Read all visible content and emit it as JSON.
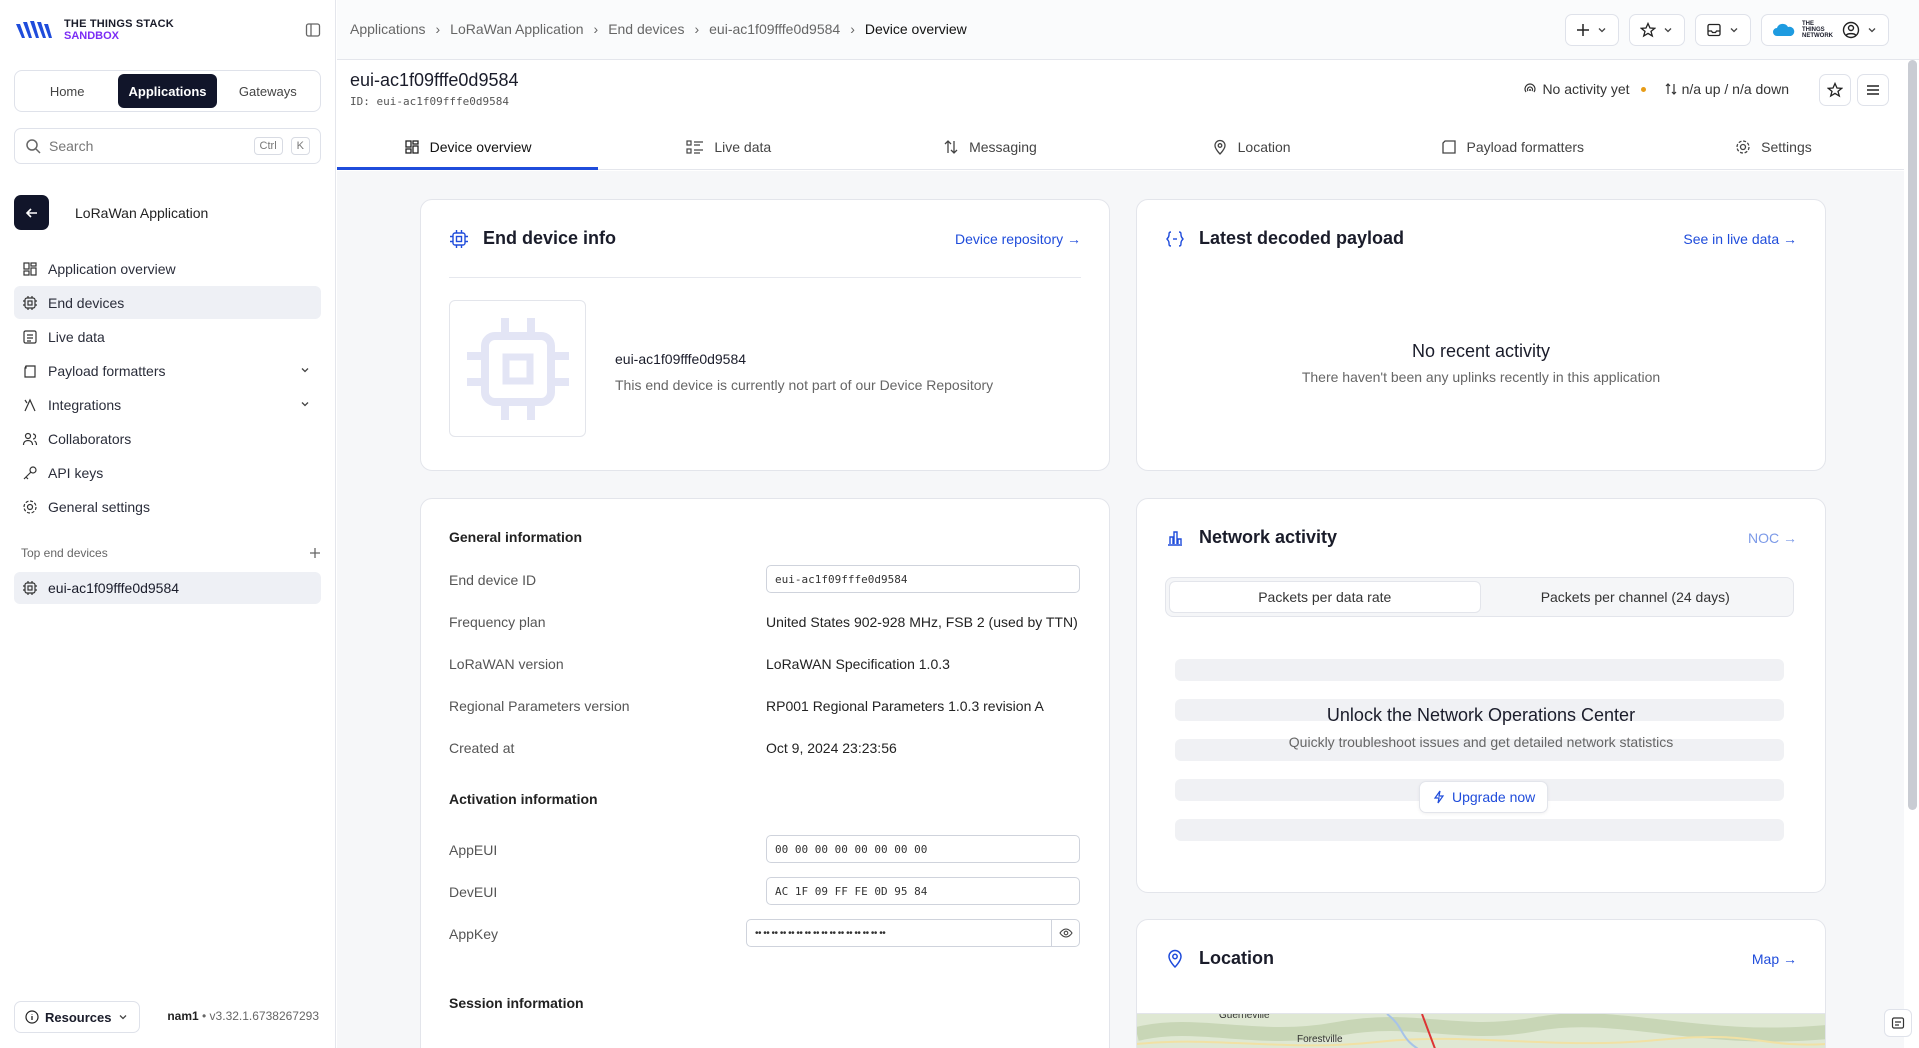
{
  "brand": {
    "line1": "THE THINGS STACK",
    "line2": "SANDBOX"
  },
  "nav_switch": {
    "home": "Home",
    "applications": "Applications",
    "gateways": "Gateways"
  },
  "search": {
    "placeholder": "Search",
    "kbd1": "Ctrl",
    "kbd2": "K"
  },
  "app": {
    "name": "LoRaWan Application"
  },
  "sidebar": {
    "items": [
      {
        "label": "Application overview",
        "icon": "grid-icon"
      },
      {
        "label": "End devices",
        "icon": "chip-icon"
      },
      {
        "label": "Live data",
        "icon": "list-icon"
      },
      {
        "label": "Payload formatters",
        "icon": "code-icon"
      },
      {
        "label": "Integrations",
        "icon": "integration-icon"
      },
      {
        "label": "Collaborators",
        "icon": "users-icon"
      },
      {
        "label": "API keys",
        "icon": "key-icon"
      },
      {
        "label": "General settings",
        "icon": "gear-icon"
      }
    ],
    "top_devices_label": "Top end devices",
    "top_device": "eui-ac1f09fffe0d9584"
  },
  "footer": {
    "resources": "Resources",
    "cluster": "nam1",
    "version": " • v3.32.1.6738267293"
  },
  "breadcrumb": [
    "Applications",
    "LoRaWan Application",
    "End devices",
    "eui-ac1f09fffe0d9584",
    "Device overview"
  ],
  "topbar": {
    "network_label": "THE THINGS NETWORK"
  },
  "device": {
    "title": "eui-ac1f09fffe0d9584",
    "id_line": "ID: eui-ac1f09fffe0d9584",
    "activity": "No activity yet",
    "traffic": "n/a up / n/a down"
  },
  "tabs": [
    "Device overview",
    "Live data",
    "Messaging",
    "Location",
    "Payload formatters",
    "Settings"
  ],
  "end_device_info": {
    "title": "End device info",
    "link": "Device repository →",
    "eui": "eui-ac1f09fffe0d9584",
    "desc": "This end device is currently not part of our Device Repository"
  },
  "latest_payload": {
    "title": "Latest decoded payload",
    "link": "See in live data →",
    "empty_title": "No recent activity",
    "empty_desc": "There haven't been any uplinks recently in this application"
  },
  "general": {
    "section": "General information",
    "rows": [
      {
        "label": "End device ID",
        "value": "eui-ac1f09fffe0d9584"
      },
      {
        "label": "Frequency plan",
        "value": "United States 902-928 MHz, FSB 2 (used by TTN)"
      },
      {
        "label": "LoRaWAN version",
        "value": "LoRaWAN Specification 1.0.3"
      },
      {
        "label": "Regional Parameters version",
        "value": "RP001 Regional Parameters 1.0.3 revision A"
      },
      {
        "label": "Created at",
        "value": "Oct 9, 2024 23:23:56"
      }
    ],
    "activation_section": "Activation information",
    "activation": [
      {
        "label": "AppEUI",
        "value": "00 00 00 00 00 00 00 00"
      },
      {
        "label": "DevEUI",
        "value": "AC 1F 09 FF FE 0D 95 84"
      },
      {
        "label": "AppKey",
        "value": "•• •• •• •• •• •• •• •• •• •• •• •• •• •• •• ••"
      }
    ],
    "session_section": "Session information"
  },
  "network_activity": {
    "title": "Network activity",
    "link": "NOC →",
    "seg1": "Packets per data rate",
    "seg2": "Packets per channel (24 days)",
    "unlock_title": "Unlock the Network Operations Center",
    "unlock_desc": "Quickly troubleshoot issues and get detailed network statistics",
    "upgrade": "Upgrade now"
  },
  "location": {
    "title": "Location",
    "link": "Map →",
    "map_label1": "Guerneville",
    "map_label2": "Forestville"
  },
  "colors": {
    "accent": "#1f4cdb",
    "dark": "#11152a",
    "brand_purple": "#7b2cf5"
  }
}
